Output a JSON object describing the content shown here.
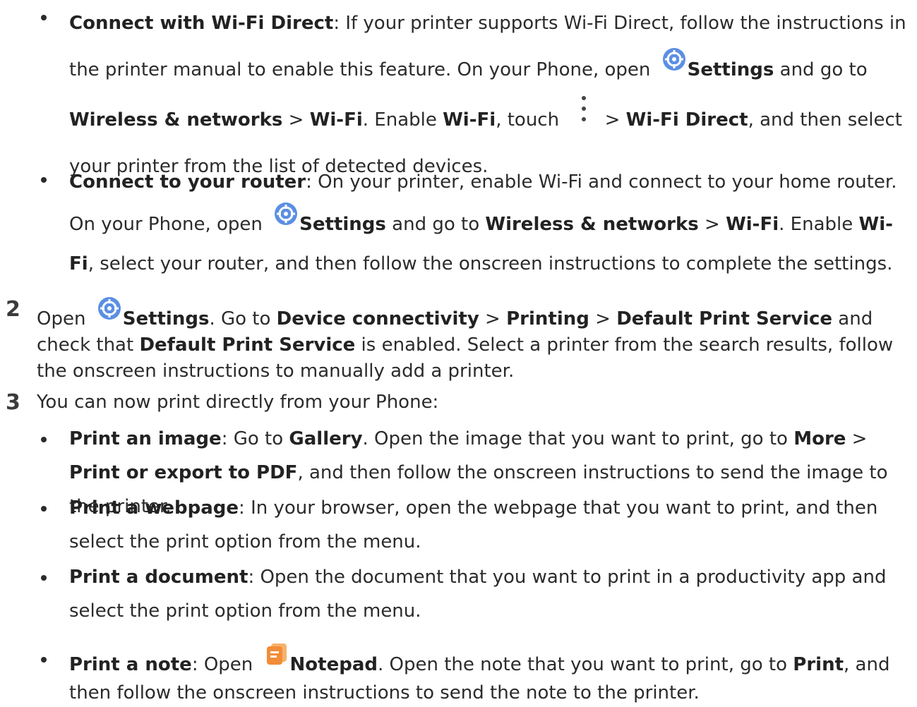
{
  "bullets_top": [
    {
      "title": "Connect with Wi-Fi Direct",
      "t1": ": If your printer supports Wi-Fi Direct, follow the instructions in the printer manual to enable this feature. On your Phone, open ",
      "settings": "Settings",
      "t2": " and go to ",
      "wireless": "Wireless & networks",
      "sep1": " > ",
      "wifi": "Wi-Fi",
      "t3": ". Enable ",
      "wifi2": "Wi-Fi",
      "t4": ", touch ",
      "t5": " > ",
      "wifi_direct": "Wi-Fi Direct",
      "t6": ", and then select your printer from the list of detected devices."
    },
    {
      "title": "Connect to your router",
      "t1": ": On your printer, enable Wi-Fi and connect to your home router. On your Phone, open ",
      "settings": "Settings",
      "t2": " and go to ",
      "wireless": "Wireless & networks",
      "sep1": " > ",
      "wifi": "Wi-Fi",
      "t3": ". Enable ",
      "wifi2": "Wi-Fi",
      "t4": ", select your router, and then follow the onscreen instructions to complete the settings."
    }
  ],
  "step2": {
    "num": "2",
    "t1": "Open ",
    "settings": "Settings",
    "t2": ". Go to ",
    "device": "Device connectivity",
    "sep1": " > ",
    "printing": "Printing",
    "sep2": " > ",
    "dps": "Default Print Service",
    "t3": " and check that ",
    "dps2": "Default Print Service",
    "t4": " is enabled. Select a printer from the search results, follow the onscreen instructions to manually add a printer."
  },
  "step3": {
    "num": "3",
    "text": "You can now print directly from your Phone:"
  },
  "bullets_bottom": [
    {
      "title": "Print an image",
      "t1": ": Go to ",
      "gallery": "Gallery",
      "t2": ". Open the image that you want to print, go to ",
      "more": "More",
      "sep": " > ",
      "print_export": "Print or export to PDF",
      "t3": ", and then follow the onscreen instructions to send the image to the printer."
    },
    {
      "title": "Print a webpage",
      "t1": ": In your browser, open the webpage that you want to print, and then select the print option from the menu."
    },
    {
      "title": "Print a document",
      "t1": ": Open the document that you want to print in a productivity app and select the print option from the menu."
    },
    {
      "title": "Print a note",
      "t1": ": Open ",
      "notepad": "Notepad",
      "t2": ". Open the note that you want to print, go to ",
      "print": "Print",
      "t3": ", and then follow the onscreen instructions to send the note to the printer."
    }
  ],
  "icons": {
    "settings": "settings-icon",
    "more": "more-vertical-icon",
    "notepad": "notepad-icon"
  },
  "colors": {
    "text": "#2b2b2b",
    "settings_icon": "#5b8fe3",
    "notepad_icon": "#f28c38"
  }
}
